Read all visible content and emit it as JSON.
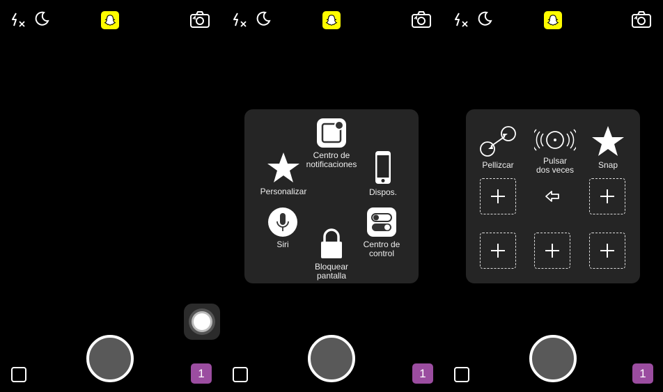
{
  "colors": {
    "snap_yellow": "#FFFC00",
    "badge_purple": "#9B4DA0",
    "menu_bg": "#252525",
    "shutter_gray": "#595959"
  },
  "camera": {
    "badge_count": "1",
    "icons": [
      "flash-off-icon",
      "moon-icon",
      "snapchat-ghost-icon",
      "flip-camera-icon",
      "memories-icon"
    ]
  },
  "assistive_menu": {
    "items": [
      {
        "label": "Centro de notificaciones",
        "line1": "Centro de",
        "line2": "notificaciones",
        "icon": "notification-center-icon"
      },
      {
        "label": "Personalizar",
        "icon": "star-icon"
      },
      {
        "label": "Dispos.",
        "icon": "iphone-icon"
      },
      {
        "label": "Siri",
        "icon": "microphone-icon"
      },
      {
        "label": "Centro de control",
        "line1": "Centro de",
        "line2": "control",
        "icon": "toggles-icon"
      },
      {
        "label": "Bloquear pantalla",
        "line1": "Bloquear",
        "line2": "pantalla",
        "icon": "lock-icon"
      }
    ]
  },
  "custom_menu": {
    "pinch": "Pellizcar",
    "double_tap_line1": "Pulsar",
    "double_tap_line2": "dos veces",
    "snap": "Snap",
    "add_icon": "plus-icon",
    "back_icon": "back-arrow-icon"
  }
}
